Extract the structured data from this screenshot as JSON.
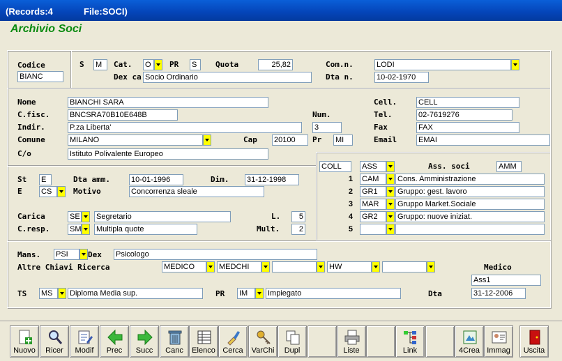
{
  "titlebar": {
    "records": "(Records:4",
    "file": "File:SOCI)"
  },
  "app_title": "Archivio Soci",
  "sec1": {
    "codice_label": "Codice",
    "codice_value": "BIANC",
    "s_label": "S",
    "s_value": "M",
    "cat_label": "Cat.",
    "cat_value": "O",
    "pr_label": "PR",
    "pr_value": "S",
    "quota_label": "Quota",
    "quota_value": "25,82",
    "comn_label": "Com.n.",
    "comn_value": "LODI",
    "dex_label": "Dex ca",
    "dex_value": "Socio Ordinario",
    "dtan_label": "Dta n.",
    "dtan_value": "10-02-1970"
  },
  "sec2": {
    "nome_label": "Nome",
    "nome_value": "BIANCHI SARA",
    "cell_label": "Cell.",
    "cell_value": "CELL",
    "cfisc_label": "C.fisc.",
    "cfisc_value": "BNCSRA70B10E648B",
    "num_label": "Num.",
    "tel_label": "Tel.",
    "tel_value": "02-7619276",
    "indir_label": "Indir.",
    "indir_value": "P.za Liberta'",
    "num_value": "3",
    "fax_label": "Fax",
    "fax_value": "FAX",
    "comune_label": "Comune",
    "comune_value": "MILANO",
    "cap_label": "Cap",
    "cap_value": "20100",
    "pr_label": "Pr",
    "pr_value": "MI",
    "email_label": "Email",
    "email_value": "EMAI",
    "co_label": "C/o",
    "co_value": "Istituto Polivalente Europeo"
  },
  "sec3": {
    "st_label": "St",
    "st_value": "E",
    "dtaamm_label": "Dta amm.",
    "dtaamm_value": "10-01-1996",
    "dim_label": "Dim.",
    "dim_value": "31-12-1998",
    "e_label": "E",
    "e_value": "CS",
    "motivo_label": "Motivo",
    "motivo_value": "Concorrenza sleale",
    "carica_label": "Carica",
    "carica_code": "SE",
    "carica_value": "Segretario",
    "l_label": "L.",
    "l_value": "5",
    "cresp_label": "C.resp.",
    "cresp_code": "SM",
    "cresp_value": "Multipla quote",
    "mult_label": "Mult.",
    "mult_value": "2"
  },
  "assoc": {
    "coll_value": "COLL",
    "ass_value": "ASS",
    "label": "Ass. soci",
    "amm_value": "AMM",
    "rows": [
      {
        "num": "1",
        "code": "CAM",
        "desc": "Cons. Amministrazione"
      },
      {
        "num": "2",
        "code": "GR1",
        "desc": "Gruppo: gest. lavoro"
      },
      {
        "num": "3",
        "code": "MAR",
        "desc": "Gruppo Market.Sociale"
      },
      {
        "num": "4",
        "code": "GR2",
        "desc": "Gruppo: nuove iniziat."
      },
      {
        "num": "5",
        "code": "",
        "desc": ""
      }
    ]
  },
  "sec4": {
    "mans_label": "Mans.",
    "mans_code": "PSI",
    "dex_label": "Dex",
    "mans_value": "Psicologo",
    "altre_label": "Altre Chiavi Ricerca",
    "key1": "MEDICO",
    "key2": "MEDCHI",
    "key3": "",
    "key4": "HW",
    "key5": "",
    "medico_label": "Medico",
    "medico_value": "Ass1",
    "ts_label": "TS",
    "ts_code": "MS",
    "ts_value": "Diploma Media sup.",
    "pr_label": "PR",
    "pr_code": "IM",
    "pr_value": "Impiegato",
    "dta_label": "Dta",
    "dta_value": "31-12-2006"
  },
  "toolbar": {
    "nuovo": "Nuovo",
    "ricer": "Ricer",
    "modif": "Modif",
    "prec": "Prec",
    "succ": "Succ",
    "canc": "Canc",
    "elenco": "Elenco",
    "cerca": "Cerca",
    "varchi": "VarChi",
    "dupl": "Dupl",
    "liste": "Liste",
    "link": "Link",
    "crea": "4Crea",
    "immag": "Immag",
    "uscita": "Uscita"
  },
  "colors": {
    "titlebar": "#0a5fd8",
    "title_green": "#0a8a10",
    "dropdown": "#ffff00"
  }
}
